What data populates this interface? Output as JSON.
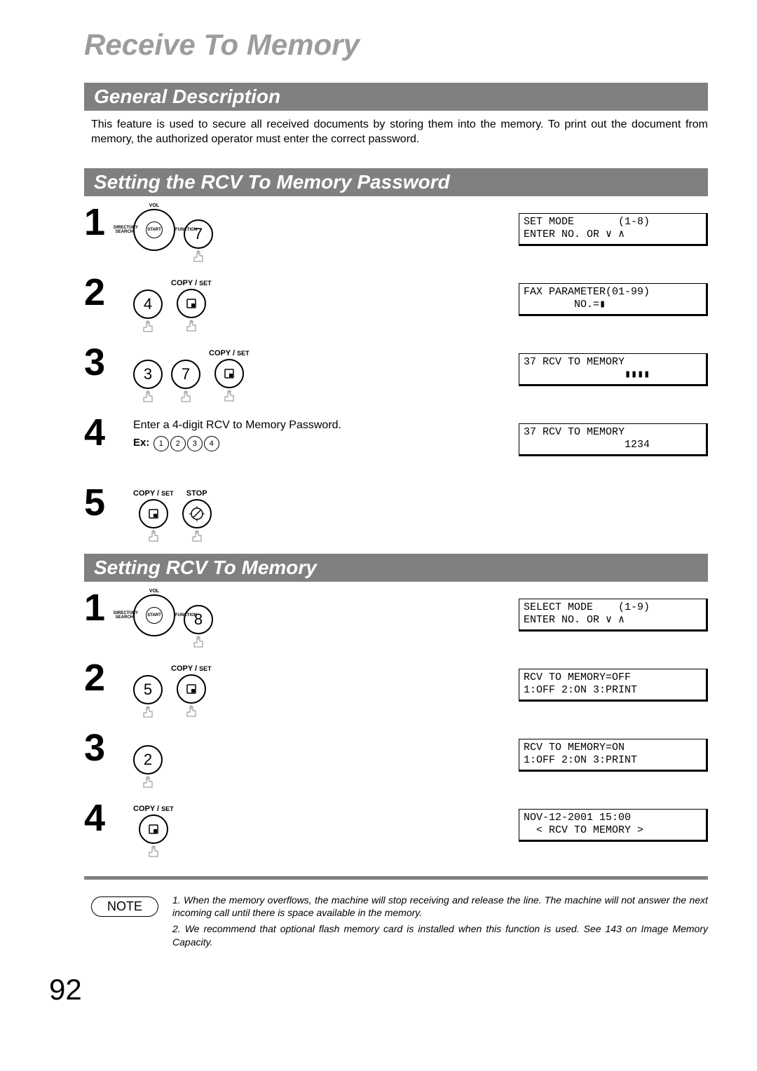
{
  "title": "Receive To Memory",
  "sections": {
    "general": {
      "heading": "General Description",
      "text": "This feature is used to secure all received documents by storing them into the memory.  To print out the document from memory, the authorized operator must enter the correct password."
    },
    "password": {
      "heading": "Setting the RCV To Memory Password",
      "steps": [
        {
          "num": "1",
          "buttons": [
            "dial",
            "7"
          ],
          "lcd": "SET MODE       (1-8)\nENTER NO. OR ∨ ∧"
        },
        {
          "num": "2",
          "label": "COPY / SET",
          "buttons": [
            "4",
            "set"
          ],
          "lcd": "FAX PARAMETER(01-99)\n        NO.=▮"
        },
        {
          "num": "3",
          "label": "COPY / SET",
          "buttons": [
            "3",
            "7",
            "set"
          ],
          "lcd": "37 RCV TO MEMORY\n                ▮▮▮▮"
        },
        {
          "num": "4",
          "text": "Enter a 4-digit RCV to Memory Password.",
          "ex_prefix": "Ex:",
          "ex_digits": [
            "1",
            "2",
            "3",
            "4"
          ],
          "lcd": "37 RCV TO MEMORY\n                1234"
        },
        {
          "num": "5",
          "labels": [
            "COPY / SET",
            "STOP"
          ],
          "buttons": [
            "set",
            "stop"
          ]
        }
      ]
    },
    "setting": {
      "heading": "Setting RCV To Memory",
      "steps": [
        {
          "num": "1",
          "buttons": [
            "dial",
            "8"
          ],
          "lcd": "SELECT MODE    (1-9)\nENTER NO. OR ∨ ∧"
        },
        {
          "num": "2",
          "label": "COPY / SET",
          "buttons": [
            "5",
            "set"
          ],
          "lcd": "RCV TO MEMORY=OFF\n1:OFF 2:ON 3:PRINT"
        },
        {
          "num": "3",
          "buttons": [
            "2"
          ],
          "lcd": "RCV TO MEMORY=ON\n1:OFF 2:ON 3:PRINT"
        },
        {
          "num": "4",
          "label": "COPY / SET",
          "buttons": [
            "set"
          ],
          "lcd": "NOV-12-2001 15:00\n  < RCV TO MEMORY >"
        }
      ]
    }
  },
  "dial": {
    "top": "VOL",
    "center": "START",
    "left": "DIRECTORY\nSEARCH",
    "right": "FUNCTION"
  },
  "copy_set_label": "COPY / ",
  "copy_set_small": "SET",
  "stop_label": "STOP",
  "note": {
    "badge": "NOTE",
    "items": [
      "1. When the memory overflows, the machine will stop receiving and release the line.  The machine will not answer the next incoming call until there is space available in the memory.",
      "2. We recommend that optional flash memory card is installed when this function is used. See 143 on Image Memory Capacity."
    ]
  },
  "page_number": "92"
}
